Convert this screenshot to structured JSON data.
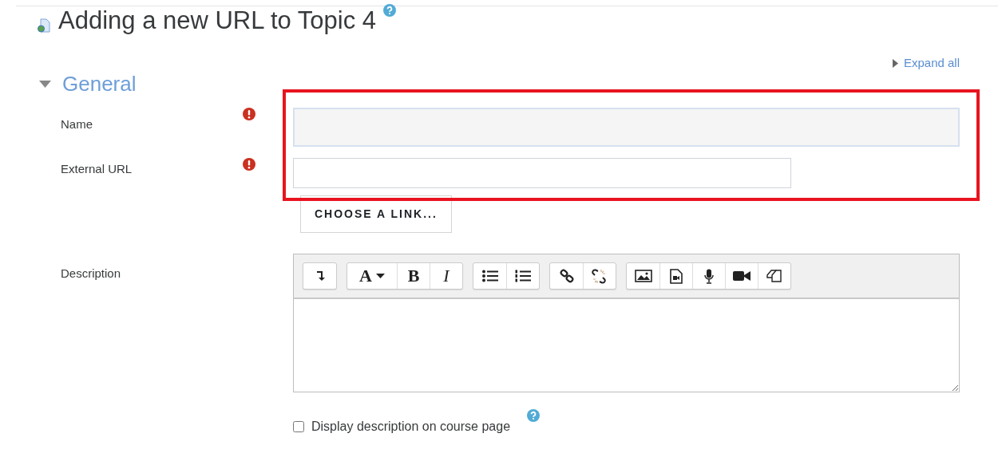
{
  "page_title": "Adding a new URL to Topic 4",
  "expand_all": "Expand all",
  "section": {
    "title": "General",
    "expanded": true
  },
  "fields": [
    {
      "label": "Name",
      "required": true,
      "wide": true
    },
    {
      "label": "External URL",
      "required": true,
      "wide": false
    }
  ],
  "choose_link_button": "CHOOSE A LINK...",
  "description": {
    "label": "Description",
    "toolbar": [
      [
        {
          "kind": "collapse"
        }
      ],
      [
        {
          "kind": "font",
          "label": "A"
        },
        {
          "kind": "bold",
          "label": "B"
        },
        {
          "kind": "italic",
          "label": "I"
        }
      ],
      [
        {
          "kind": "bullets"
        },
        {
          "kind": "numbers"
        }
      ],
      [
        {
          "kind": "link"
        },
        {
          "kind": "unlink"
        }
      ],
      [
        {
          "kind": "image"
        },
        {
          "kind": "media"
        },
        {
          "kind": "audio"
        },
        {
          "kind": "video"
        },
        {
          "kind": "copy"
        }
      ]
    ]
  },
  "display_description": {
    "label": "Display description on course page",
    "checked": false
  },
  "highlight_box": true
}
